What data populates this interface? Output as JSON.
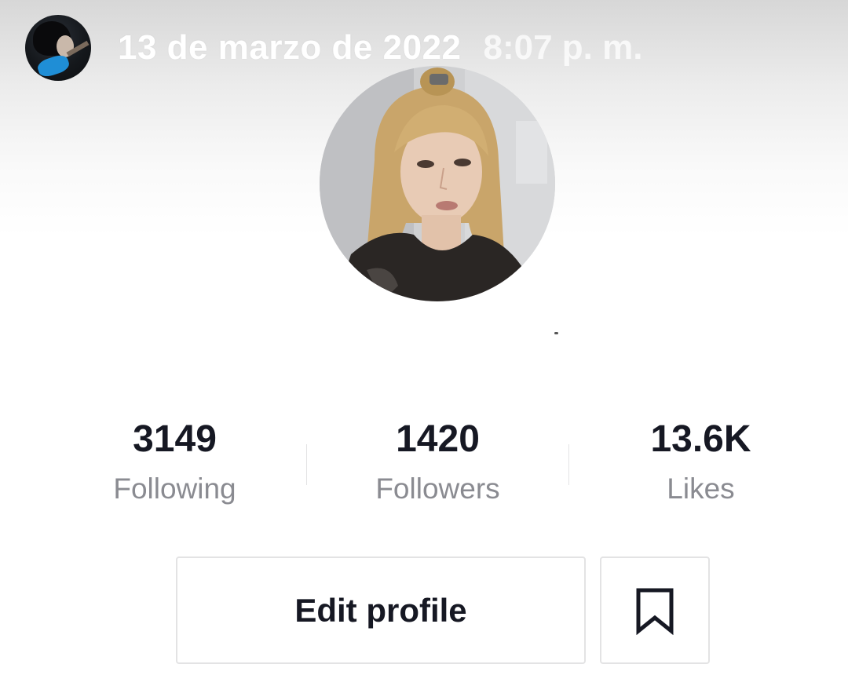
{
  "story": {
    "date": "13 de marzo de 2022",
    "time": "8:07 p. m."
  },
  "stats": [
    {
      "value": "3149",
      "label": "Following"
    },
    {
      "value": "1420",
      "label": "Followers"
    },
    {
      "value": "13.6K",
      "label": "Likes"
    }
  ],
  "actions": {
    "edit_profile_label": "Edit profile"
  },
  "icons": {
    "bookmark": "bookmark-icon"
  },
  "colors": {
    "text_primary": "#161823",
    "text_secondary": "#8a8b91",
    "border": "#e3e3e4"
  }
}
